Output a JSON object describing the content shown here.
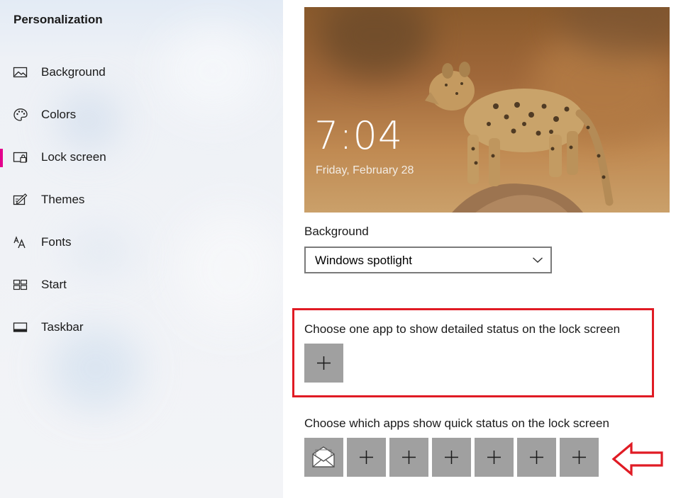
{
  "sidebar": {
    "title": "Personalization",
    "items": [
      {
        "label": "Background",
        "icon": "image-icon",
        "selected": false
      },
      {
        "label": "Colors",
        "icon": "palette-icon",
        "selected": false
      },
      {
        "label": "Lock screen",
        "icon": "lock-screen-icon",
        "selected": true
      },
      {
        "label": "Themes",
        "icon": "themes-icon",
        "selected": false
      },
      {
        "label": "Fonts",
        "icon": "fonts-icon",
        "selected": false
      },
      {
        "label": "Start",
        "icon": "start-icon",
        "selected": false
      },
      {
        "label": "Taskbar",
        "icon": "taskbar-icon",
        "selected": false
      }
    ],
    "accent_color": "#e3008c"
  },
  "preview": {
    "time": "7:04",
    "date": "Friday, February 28"
  },
  "background_setting": {
    "label": "Background",
    "selected_value": "Windows spotlight"
  },
  "detailed_status": {
    "label": "Choose one app to show detailed status on the lock screen",
    "tiles": [
      {
        "icon": "plus-icon"
      }
    ]
  },
  "quick_status": {
    "label": "Choose which apps show quick status on the lock screen",
    "tiles": [
      {
        "icon": "mail-icon"
      },
      {
        "icon": "plus-icon"
      },
      {
        "icon": "plus-icon"
      },
      {
        "icon": "plus-icon"
      },
      {
        "icon": "plus-icon"
      },
      {
        "icon": "plus-icon"
      },
      {
        "icon": "plus-icon"
      }
    ]
  },
  "annotations": {
    "highlight_color": "#e01b24",
    "arrow_icon": "left-arrow-outline-icon"
  }
}
